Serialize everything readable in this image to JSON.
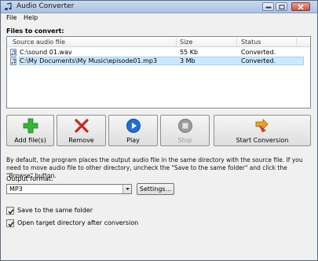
{
  "window": {
    "title": "Audio Converter"
  },
  "menu": {
    "file": "File",
    "help": "Help"
  },
  "files_label": "Files to convert:",
  "columns": {
    "source": "Source audio file",
    "size": "Size",
    "status": "Status"
  },
  "files": [
    {
      "name": "C:\\sound 01.wav",
      "size": "55 Kb",
      "status": "Converted."
    },
    {
      "name": "C:\\My Documents\\My Music\\episode01.mp3",
      "size": "3 Mb",
      "status": "Converted."
    }
  ],
  "toolbar": {
    "add": "Add file(s)",
    "remove": "Remove",
    "play": "Play",
    "stop": "Stop",
    "start": "Start Conversion"
  },
  "info_text": "By default, the program places the output audio file in the same directory with the source file. If you need to move audio file to other directory, uncheck the \"Save to the same folder\" and click the \"Browse\" button.",
  "output_format": {
    "label": "Output format:",
    "value": "MP3",
    "settings": "Settings..."
  },
  "options": {
    "save_same_folder": {
      "label": "Save to the same folder",
      "checked": true
    },
    "open_target_dir": {
      "label": "Open target directory after conversion",
      "checked": true
    }
  },
  "colors": {
    "selection": "#cce8ff",
    "accent_blue": "#1f6fd6",
    "add_green": "#2fae2f",
    "remove_red": "#c8281f"
  }
}
